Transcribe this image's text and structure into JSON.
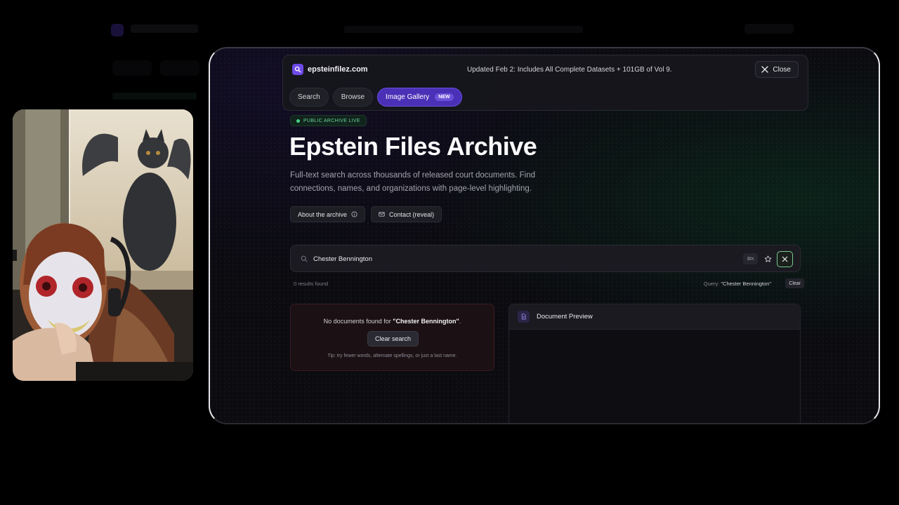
{
  "header": {
    "brand": "epsteinfilez.com",
    "banner": "Updated Feb 2: Includes All Complete Datasets + 101GB of Vol 9.",
    "close_label": "Close"
  },
  "tabs": [
    {
      "label": "Search"
    },
    {
      "label": "Browse"
    },
    {
      "label": "Image Gallery",
      "badge": "NEW"
    }
  ],
  "hero": {
    "badge": "PUBLIC ARCHIVE LIVE",
    "title": "Epstein Files Archive",
    "description": "Full-text search across thousands of released court documents. Find connections, names, and organizations with page-level highlighting.",
    "about_label": "About the archive",
    "contact_label": "Contact (reveal)"
  },
  "search": {
    "value": "Chester Bennington",
    "shortcut": "⌘K",
    "results_count": "0 results found",
    "query_prefix": "Query:",
    "query_value": "\"Chester Bennington\"",
    "clear_label": "Clear"
  },
  "empty_state": {
    "message_prefix": "No documents found for",
    "message_query": "\"Chester Bennington\"",
    "message_suffix": ".",
    "clear_button": "Clear search",
    "tip": "Tip: try fewer words, alternate spellings, or just a last name."
  },
  "preview": {
    "title": "Document Preview"
  },
  "colors": {
    "accent": "#4a30b6",
    "live_green": "#46d487",
    "background": "#0b0b10"
  },
  "icons": {
    "brand": "search-icon",
    "close": "close-icon",
    "about": "info-icon",
    "contact": "mail-icon",
    "favorite": "star-icon",
    "clear": "close-icon",
    "preview": "document-icon"
  }
}
